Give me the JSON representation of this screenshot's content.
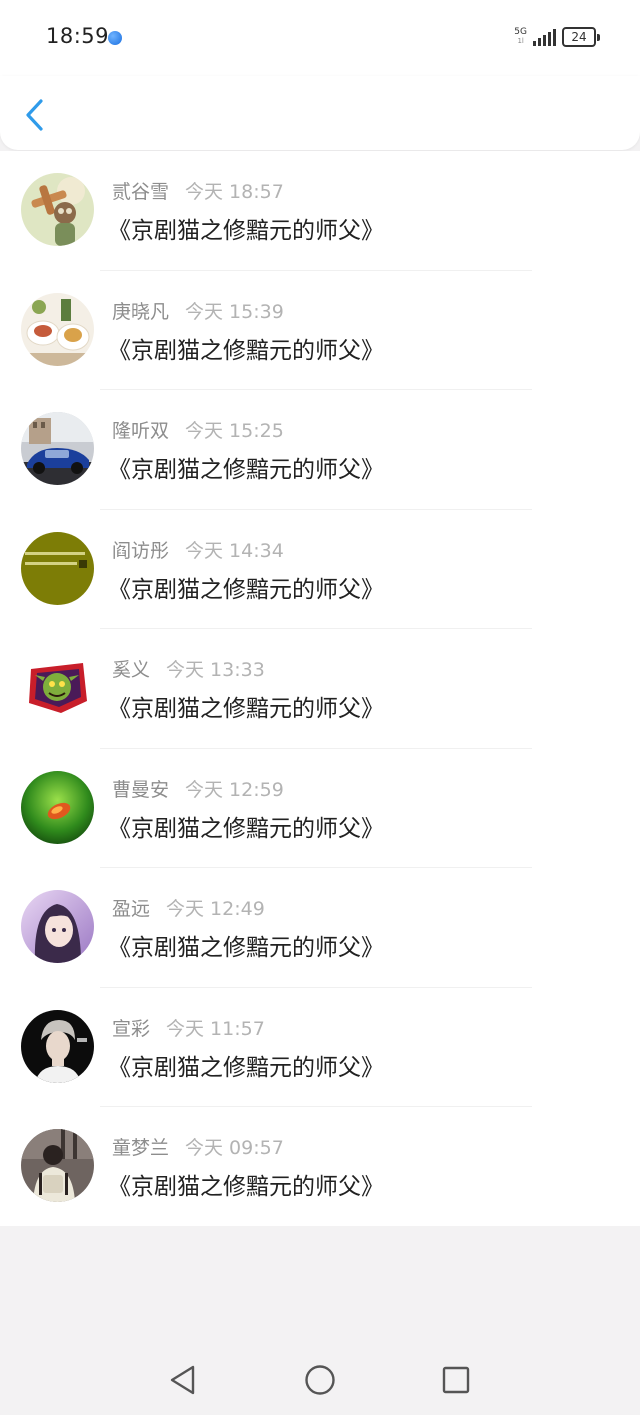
{
  "status_bar": {
    "time": "18:59",
    "network": "5G",
    "network_sub": "1l",
    "battery": "24"
  },
  "header": {
    "back_icon": "chevron-left-icon",
    "accent_color": "#2f9bea"
  },
  "messages": [
    {
      "name": "贰谷雪",
      "time": "今天 18:57",
      "text": "《京剧猫之修黯元的师父》",
      "avatar": "cartoon-airplane-avatar"
    },
    {
      "name": "庚晓凡",
      "time": "今天 15:39",
      "text": "《京剧猫之修黯元的师父》",
      "avatar": "food-plates-avatar"
    },
    {
      "name": "隆听双",
      "time": "今天 15:25",
      "text": "《京剧猫之修黯元的师父》",
      "avatar": "blue-car-avatar"
    },
    {
      "name": "阎访彤",
      "time": "今天 14:34",
      "text": "《京剧猫之修黯元的师父》",
      "avatar": "olive-text-avatar"
    },
    {
      "name": "奚义",
      "time": "今天 13:33",
      "text": "《京剧猫之修黯元的师父》",
      "avatar": "goblin-sticker-avatar"
    },
    {
      "name": "曹曼安",
      "time": "今天 12:59",
      "text": "《京剧猫之修黯元的师父》",
      "avatar": "green-leaf-avatar"
    },
    {
      "name": "盈远",
      "time": "今天 12:49",
      "text": "《京剧猫之修黯元的师父》",
      "avatar": "anime-girl-avatar"
    },
    {
      "name": "宣彩",
      "time": "今天 11:57",
      "text": "《京剧猫之修黯元的师父》",
      "avatar": "portrait-photo-avatar"
    },
    {
      "name": "童梦兰",
      "time": "今天 09:57",
      "text": "《京剧猫之修黯元的师父》",
      "avatar": "backpack-photo-avatar"
    }
  ],
  "nav_bar": {
    "back": "triangle-back-icon",
    "home": "circle-home-icon",
    "recents": "square-recents-icon"
  }
}
